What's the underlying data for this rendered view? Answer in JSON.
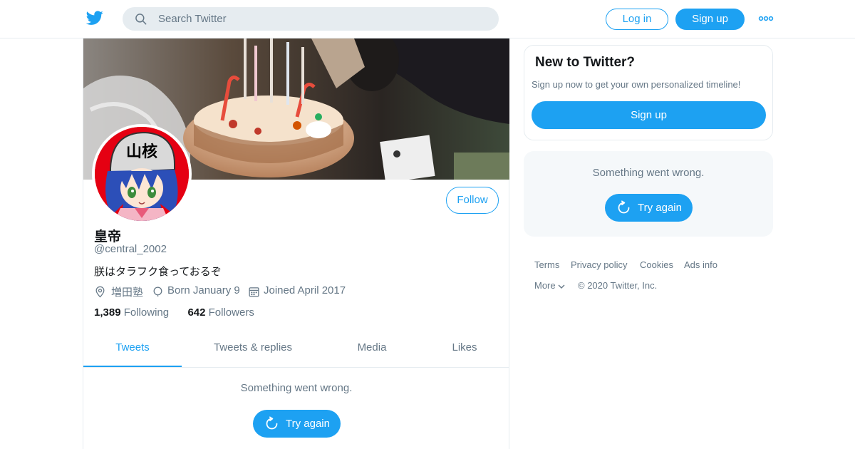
{
  "header": {
    "search_placeholder": "Search Twitter",
    "login_label": "Log in",
    "signup_label": "Sign up"
  },
  "profile": {
    "display_name": "皇帝",
    "handle": "@central_2002",
    "bio": "朕はタラフク食っておるぞ",
    "location": "増田塾",
    "birthday": "Born January 9",
    "joined": "Joined April 2017",
    "following_count": "1,389",
    "following_label": "Following",
    "followers_count": "642",
    "followers_label": "Followers",
    "follow_label": "Follow",
    "avatar_text": "山核"
  },
  "tabs": [
    {
      "label": "Tweets",
      "active": true
    },
    {
      "label": "Tweets & replies",
      "active": false
    },
    {
      "label": "Media",
      "active": false
    },
    {
      "label": "Likes",
      "active": false
    }
  ],
  "timeline": {
    "error_message": "Something went wrong.",
    "retry_label": "Try again"
  },
  "sidebar": {
    "new_title": "New to Twitter?",
    "new_text": "Sign up now to get your own personalized timeline!",
    "new_signup_label": "Sign up",
    "error_message": "Something went wrong.",
    "retry_label": "Try again"
  },
  "footer": {
    "terms": "Terms",
    "privacy": "Privacy policy",
    "cookies": "Cookies",
    "ads_info": "Ads info",
    "more": "More",
    "copyright": "© 2020 Twitter, Inc."
  },
  "colors": {
    "accent": "#1da1f2",
    "secondary_text": "#657786",
    "avatar_background": "#e50012"
  },
  "icons": [
    "twitter-bird-icon",
    "search-icon",
    "more-dots-icon",
    "location-icon",
    "balloon-icon",
    "calendar-icon",
    "refresh-icon",
    "chevron-down-icon"
  ]
}
